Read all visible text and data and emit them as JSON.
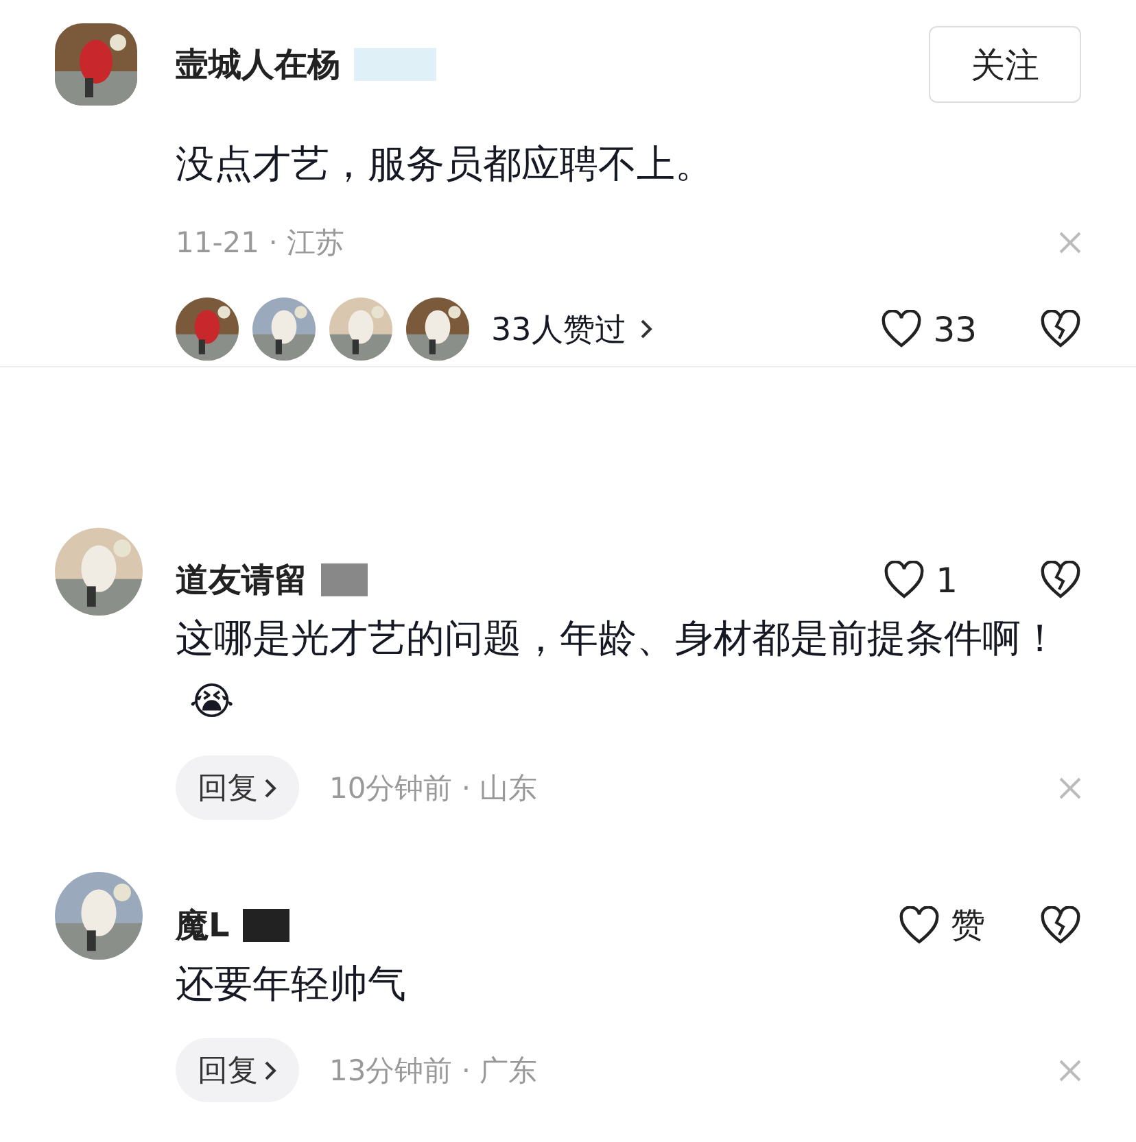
{
  "post": {
    "username": "壸城人在杨",
    "follow_button": "关注",
    "text": "没点才艺，服务员都应聘不上。",
    "meta": "11-21 · 江苏",
    "likers_text": "33人赞过",
    "like_count": "33",
    "liked": false
  },
  "replies": [
    {
      "username": "道友请留",
      "like_label": "1",
      "liked": false,
      "text": "这哪是光才艺的问题，年龄、身材都是前提条件啊！",
      "emoji": "😭",
      "reply_button": "回复",
      "meta": "10分钟前 · 山东"
    },
    {
      "username": "魔L",
      "like_label": "赞",
      "liked": false,
      "text": "还要年轻帅气",
      "reply_button": "回复",
      "meta": "13分钟前 · 广东"
    }
  ]
}
